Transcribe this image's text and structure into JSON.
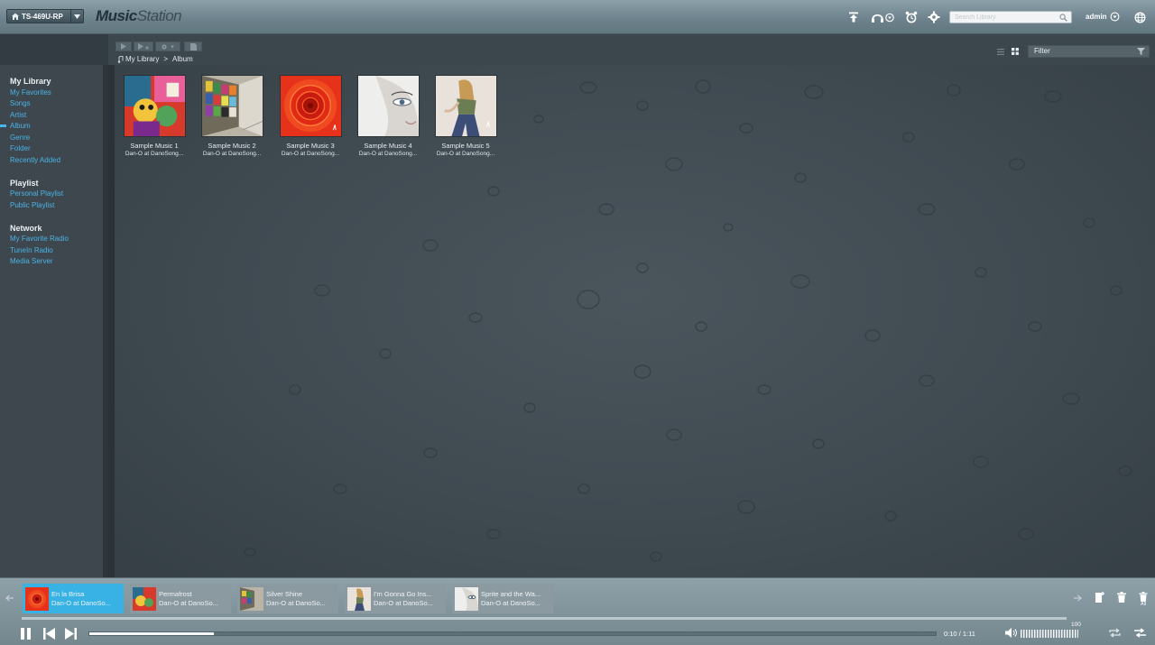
{
  "device": {
    "name": "TS-469U-RP"
  },
  "brand": {
    "part1": "Music",
    "part2": "Station"
  },
  "search": {
    "placeholder": "Search Library"
  },
  "user": {
    "name": "admin"
  },
  "breadcrumb": {
    "root": "My Library",
    "separator": ">",
    "current": "Album"
  },
  "filter": {
    "placeholder": "Filter"
  },
  "sidebar": {
    "sections": [
      {
        "heading": "My Library",
        "items": [
          "My Favorites",
          "Songs",
          "Artist",
          "Album",
          "Genre",
          "Folder",
          "Recently Added"
        ]
      },
      {
        "heading": "Playlist",
        "items": [
          "Personal Playlist",
          "Public Playlist"
        ]
      },
      {
        "heading": "Network",
        "items": [
          "My Favorite Radio",
          "TuneIn Radio",
          "Media Server"
        ]
      }
    ],
    "selected": "Album"
  },
  "albums": [
    {
      "title": "Sample Music 1",
      "artist": "Dan-O at DanoSong...",
      "art": "colorful-art"
    },
    {
      "title": "Sample Music 2",
      "artist": "Dan-O at DanoSong...",
      "art": "subway-tiles"
    },
    {
      "title": "Sample Music 3",
      "artist": "Dan-O at DanoSong...",
      "art": "red-rose"
    },
    {
      "title": "Sample Music 4",
      "artist": "Dan-O at DanoSong...",
      "art": "face-closeup"
    },
    {
      "title": "Sample Music 5",
      "artist": "Dan-O at DanoSong...",
      "art": "dancing-figure"
    }
  ],
  "queue": [
    {
      "title": "En la Brisa",
      "artist": "Dan-O at DanoSo...",
      "active": true
    },
    {
      "title": "Permafrost",
      "artist": "Dan-O at DanoSo...",
      "active": false
    },
    {
      "title": "Silver Shine",
      "artist": "Dan-O at DanoSo...",
      "active": false
    },
    {
      "title": "I'm Gonna Go Ins...",
      "artist": "Dan-O at DanoSo...",
      "active": false
    },
    {
      "title": "Sprite and the Wa...",
      "artist": "Dan-O at DanoSo...",
      "active": false
    }
  ],
  "player": {
    "elapsed": "0:10",
    "duration": "1:11",
    "time_display": "0:10 / 1:11",
    "progress_fraction": 0.147,
    "volume": "100",
    "remove_all_label": "All"
  },
  "colors": {
    "accent": "#38b2e5",
    "link": "#4ab3e6",
    "topbar": "#7a8f99",
    "main_bg": "#414c53"
  }
}
